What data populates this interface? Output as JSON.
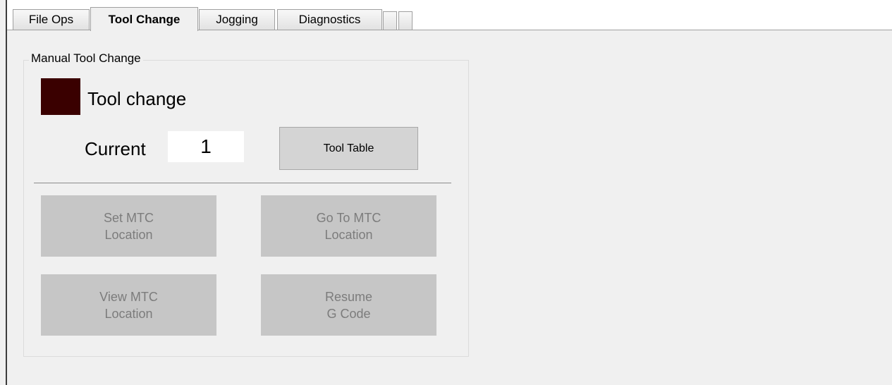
{
  "tabs": [
    {
      "label": "File Ops",
      "active": false
    },
    {
      "label": "Tool Change",
      "active": true
    },
    {
      "label": "Jogging",
      "active": false
    },
    {
      "label": "Diagnostics",
      "active": false
    },
    {
      "label": "",
      "active": false
    },
    {
      "label": "",
      "active": false
    }
  ],
  "group": {
    "title": "Manual Tool Change",
    "indicator": {
      "label": "Tool change",
      "color": "#3a0000"
    },
    "current_label": "Current",
    "current_value": "1",
    "tool_table_label": "Tool Table"
  },
  "buttons": {
    "set_mtc": {
      "line1": "Set MTC",
      "line2": "Location",
      "enabled": false
    },
    "goto_mtc": {
      "line1": "Go To MTC",
      "line2": "Location",
      "enabled": false
    },
    "view_mtc": {
      "line1": "View MTC",
      "line2": "Location",
      "enabled": false
    },
    "resume_gcode": {
      "line1": "Resume",
      "line2": "G Code",
      "enabled": false
    }
  }
}
